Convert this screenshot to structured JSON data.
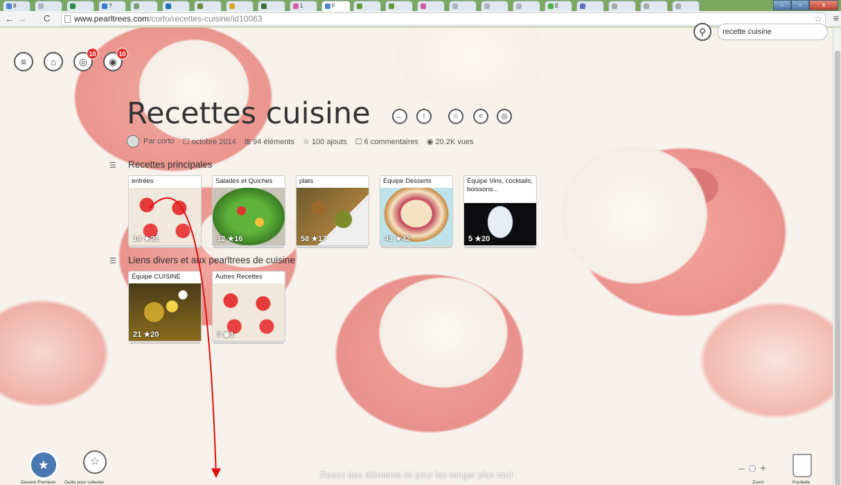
{
  "browser": {
    "tabs": [
      {
        "label": "8",
        "color": "#4a7fd4"
      },
      {
        "label": "",
        "color": "#a9b7c4"
      },
      {
        "label": "",
        "color": "#2d8a4b"
      },
      {
        "label": "?",
        "color": "#3a7bd0"
      },
      {
        "label": "",
        "color": "#7a9b7a"
      },
      {
        "label": "",
        "color": "#1f6fb5"
      },
      {
        "label": "",
        "color": "#6d8e3d"
      },
      {
        "label": "",
        "color": "#d8a32a"
      },
      {
        "label": "",
        "color": "#3c6b3c"
      },
      {
        "label": "1",
        "color": "#d05ba3"
      },
      {
        "label": "F",
        "color": "#4d86c8",
        "active": true
      },
      {
        "label": "",
        "color": "#5f9a3c"
      },
      {
        "label": "",
        "color": "#5f9a3c"
      },
      {
        "label": "",
        "color": "#d05ba3"
      },
      {
        "label": "",
        "color": "#a9b7c4"
      },
      {
        "label": "",
        "color": "#a9b7c4"
      },
      {
        "label": "",
        "color": "#a9b7c4"
      },
      {
        "label": "E",
        "color": "#4bb14b"
      },
      {
        "label": "",
        "color": "#6070c0"
      },
      {
        "label": "",
        "color": "#aaaaaa"
      },
      {
        "label": "",
        "color": "#aaaaaa"
      },
      {
        "label": "",
        "color": "#aaaaaa"
      }
    ],
    "url_host": "www.pearltrees.com",
    "url_path": "/corto/recettes-cuisine/id10063",
    "close_label": "x"
  },
  "top_buttons": {
    "badge1": "10",
    "badge2": "10"
  },
  "search": {
    "value": "recette cuisine"
  },
  "page": {
    "title": "Recettes cuisine",
    "author": "Par corto",
    "date": "octobre 2014",
    "elements": "94 éléments",
    "ajouts": "100 ajouts",
    "comments": "6 commentaires",
    "views": "20.2K vues"
  },
  "sections": [
    {
      "title": "Recettes principales",
      "cards": [
        {
          "label": "entrées",
          "stats": "14 ★21"
        },
        {
          "label": "Salades et Quiches",
          "stats": "12 ★16"
        },
        {
          "label": "plats",
          "stats": "58 ★17"
        },
        {
          "label": "Équipe Desserts",
          "stats": "41 ★42"
        },
        {
          "label": "Équipe Vins, cocktails, boissons...",
          "stats": "5 ★20"
        }
      ]
    },
    {
      "title": "Liens divers et aux pearltrees de cuisine",
      "cards": [
        {
          "label": "Équipe CUISINE",
          "stats": "21 ★20"
        },
        {
          "label": "Autres Recettes",
          "stats": "3 ◉1"
        }
      ]
    }
  ],
  "bottom": {
    "hint": "Posez des éléments ici pour les ranger plus tard",
    "premium": "Devenir Premium",
    "outils": "Outils pour collecter",
    "zoom": "Zoom",
    "trash": "Poubelle"
  }
}
